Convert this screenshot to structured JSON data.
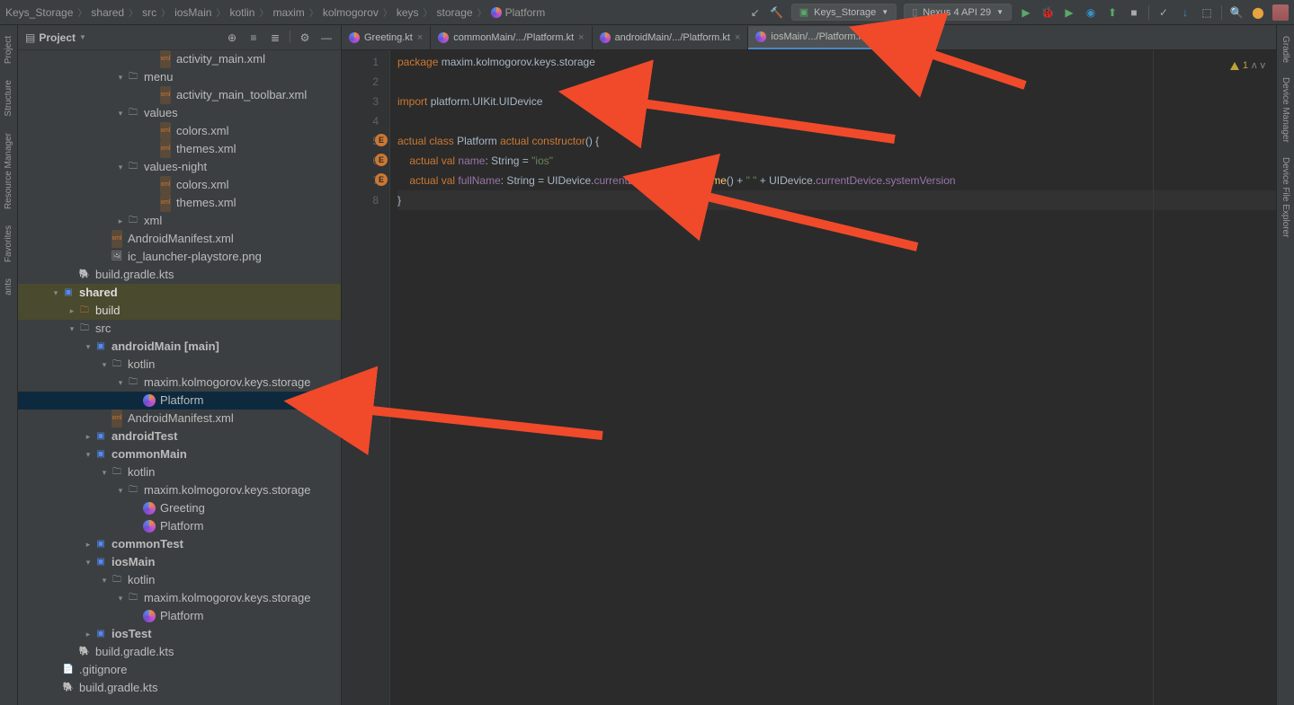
{
  "breadcrumb": [
    "Keys_Storage",
    "shared",
    "src",
    "iosMain",
    "kotlin",
    "maxim",
    "kolmogorov",
    "keys",
    "storage",
    "Platform"
  ],
  "run_config": "Keys_Storage",
  "device": "Nexus 4 API 29",
  "panel_title": "Project",
  "rails_left": [
    "Project",
    "Structure",
    "Resource Manager",
    "Favorites",
    "ants"
  ],
  "rails_right": [
    "Gradle",
    "Device Manager",
    "Device File Explorer"
  ],
  "tree": [
    {
      "d": 8,
      "a": "",
      "i": "xml",
      "t": "activity_main.xml"
    },
    {
      "d": 6,
      "a": "v",
      "i": "folder",
      "t": "menu"
    },
    {
      "d": 8,
      "a": "",
      "i": "xml",
      "t": "activity_main_toolbar.xml"
    },
    {
      "d": 6,
      "a": "v",
      "i": "folder",
      "t": "values"
    },
    {
      "d": 8,
      "a": "",
      "i": "xml",
      "t": "colors.xml"
    },
    {
      "d": 8,
      "a": "",
      "i": "xml",
      "t": "themes.xml"
    },
    {
      "d": 6,
      "a": "v",
      "i": "folder",
      "t": "values-night"
    },
    {
      "d": 8,
      "a": "",
      "i": "xml",
      "t": "colors.xml"
    },
    {
      "d": 8,
      "a": "",
      "i": "xml",
      "t": "themes.xml"
    },
    {
      "d": 6,
      "a": ">",
      "i": "folder",
      "t": "xml"
    },
    {
      "d": 5,
      "a": "",
      "i": "xml",
      "t": "AndroidManifest.xml"
    },
    {
      "d": 5,
      "a": "",
      "i": "png",
      "t": "ic_launcher-playstore.png"
    },
    {
      "d": 3,
      "a": "",
      "i": "gradle",
      "t": "build.gradle.kts"
    },
    {
      "d": 2,
      "a": "v",
      "i": "module",
      "t": "shared",
      "bold": true,
      "hl": true
    },
    {
      "d": 3,
      "a": ">",
      "i": "folder-o",
      "t": "build",
      "hl": true
    },
    {
      "d": 3,
      "a": "v",
      "i": "folder",
      "t": "src"
    },
    {
      "d": 4,
      "a": "v",
      "i": "module",
      "t": "androidMain",
      "suffix": " [main]",
      "bold": true
    },
    {
      "d": 5,
      "a": "v",
      "i": "folder",
      "t": "kotlin"
    },
    {
      "d": 6,
      "a": "v",
      "i": "folder",
      "t": "maxim.kolmogorov.keys.storage"
    },
    {
      "d": 7,
      "a": "",
      "i": "kt",
      "t": "Platform",
      "sel": true
    },
    {
      "d": 5,
      "a": "",
      "i": "xml",
      "t": "AndroidManifest.xml"
    },
    {
      "d": 4,
      "a": ">",
      "i": "module",
      "t": "androidTest",
      "bold": true
    },
    {
      "d": 4,
      "a": "v",
      "i": "module",
      "t": "commonMain",
      "bold": true
    },
    {
      "d": 5,
      "a": "v",
      "i": "folder",
      "t": "kotlin"
    },
    {
      "d": 6,
      "a": "v",
      "i": "folder",
      "t": "maxim.kolmogorov.keys.storage"
    },
    {
      "d": 7,
      "a": "",
      "i": "kt",
      "t": "Greeting"
    },
    {
      "d": 7,
      "a": "",
      "i": "kt",
      "t": "Platform"
    },
    {
      "d": 4,
      "a": ">",
      "i": "module",
      "t": "commonTest",
      "bold": true
    },
    {
      "d": 4,
      "a": "v",
      "i": "module",
      "t": "iosMain",
      "bold": true
    },
    {
      "d": 5,
      "a": "v",
      "i": "folder",
      "t": "kotlin"
    },
    {
      "d": 6,
      "a": "v",
      "i": "folder",
      "t": "maxim.kolmogorov.keys.storage"
    },
    {
      "d": 7,
      "a": "",
      "i": "kt",
      "t": "Platform"
    },
    {
      "d": 4,
      "a": ">",
      "i": "module",
      "t": "iosTest",
      "bold": true
    },
    {
      "d": 3,
      "a": "",
      "i": "gradle",
      "t": "build.gradle.kts"
    },
    {
      "d": 2,
      "a": "",
      "i": "file",
      "t": ".gitignore"
    },
    {
      "d": 2,
      "a": "",
      "i": "gradle",
      "t": "build.gradle.kts"
    }
  ],
  "tabs": [
    {
      "label": "Greeting.kt",
      "active": false
    },
    {
      "label": "commonMain/.../Platform.kt",
      "active": false
    },
    {
      "label": "androidMain/.../Platform.kt",
      "active": false
    },
    {
      "label": "iosMain/.../Platform.kt",
      "active": true
    }
  ],
  "warn_count": "1",
  "code": {
    "l1": {
      "package": "package",
      "pkg": "maxim.kolmogorov.keys.storage"
    },
    "l3": {
      "import": "import",
      "what": "platform.UIKit.UIDevice"
    },
    "l5": {
      "actual": "actual",
      "class": "class",
      "name": "Platform",
      "actual2": "actual",
      "ctor": "constructor",
      "paren": "()",
      "brace": "{"
    },
    "l6": {
      "actual": "actual",
      "val": "val",
      "name": "name",
      "colon_type": ": String =",
      "str": "\"ios\""
    },
    "l7": {
      "actual": "actual",
      "val": "val",
      "name": "fullName",
      "colon_type": ": String = ",
      "id1": "UIDevice",
      "dot1": ".",
      "fld1": "currentDevice",
      "dot2": ".",
      "fn1": "systemName",
      "call1": "()",
      "plus": " + ",
      "str": "\" \"",
      "plus2": " + ",
      "id2": "UIDevice",
      "dot3": ".",
      "fld2": "currentDevice",
      "dot4": ".",
      "fld3": "systemVersion"
    },
    "l8": {
      "brace": "}"
    }
  }
}
